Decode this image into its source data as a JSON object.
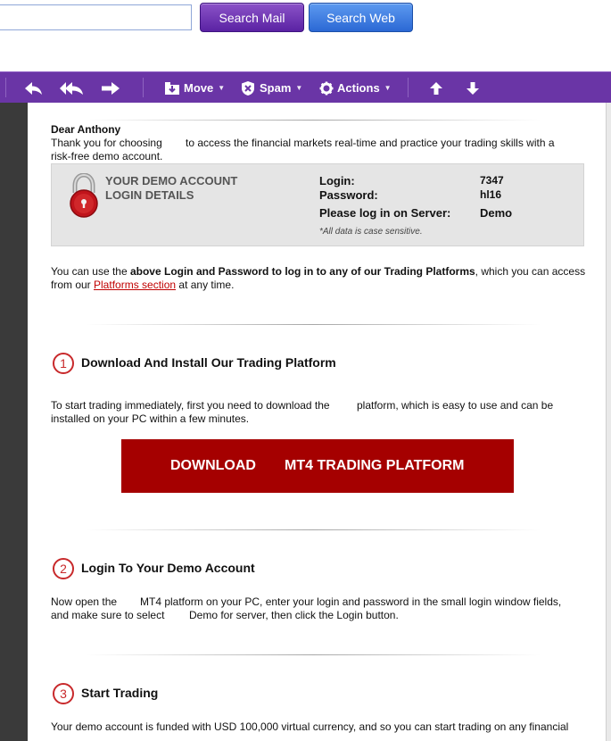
{
  "search": {
    "input_value": "",
    "mail_button": "Search Mail",
    "web_button": "Search Web"
  },
  "toolbar": {
    "move_label": "Move",
    "spam_label": "Spam",
    "actions_label": "Actions",
    "icons": [
      "reply-icon",
      "reply-all-icon",
      "forward-icon",
      "move-icon",
      "shield-icon",
      "gear-icon",
      "arrow-up-icon",
      "arrow-down-icon"
    ],
    "colors": {
      "toolbar_bg": "#6a35a6",
      "accent_red": "#a50000"
    }
  },
  "email": {
    "greeting": "Dear Anthony",
    "intro_line1_a": "Thank you for choosing",
    "intro_line1_b": "to access the financial markets real-time and practice your trading skills with a",
    "intro_line2": "risk-free demo account.",
    "login_box": {
      "title_line1": "YOUR DEMO ACCOUNT",
      "title_line2": "LOGIN DETAILS",
      "login_label": "Login:",
      "login_value": "7347",
      "password_label": "Password:",
      "password_value": "hl16",
      "server_label": "Please log in on Server:",
      "server_value": "Demo",
      "note": "*All data is case sensitive."
    },
    "platforms_para": {
      "part1": "You can use the ",
      "bold": "above Login and Password to log in to any of our Trading Platforms",
      "part2": ", which you can access",
      "line2_a": "from our ",
      "link": "Platforms section",
      "line2_b": " at any time."
    },
    "steps": [
      {
        "number": "1",
        "title": "Download And Install Our Trading Platform",
        "line1_a": "To start trading immediately, first you need to download the",
        "line1_b": "platform, which is easy to use and can be",
        "line2": "installed on your PC within a few minutes."
      },
      {
        "number": "2",
        "title": "Login To Your Demo Account",
        "line1_a": "Now open the",
        "line1_b": "MT4 platform on your PC, enter your login and password in the small login window fields,",
        "line2_a": "and make sure to select",
        "line2_b": "Demo for server, then click the Login button."
      },
      {
        "number": "3",
        "title": "Start Trading",
        "line1": "Your demo account is funded with USD 100,000 virtual currency, and so you can start trading on any financial"
      }
    ],
    "download_button": {
      "part1": "DOWNLOAD",
      "part2": "MT4 TRADING PLATFORM"
    }
  }
}
